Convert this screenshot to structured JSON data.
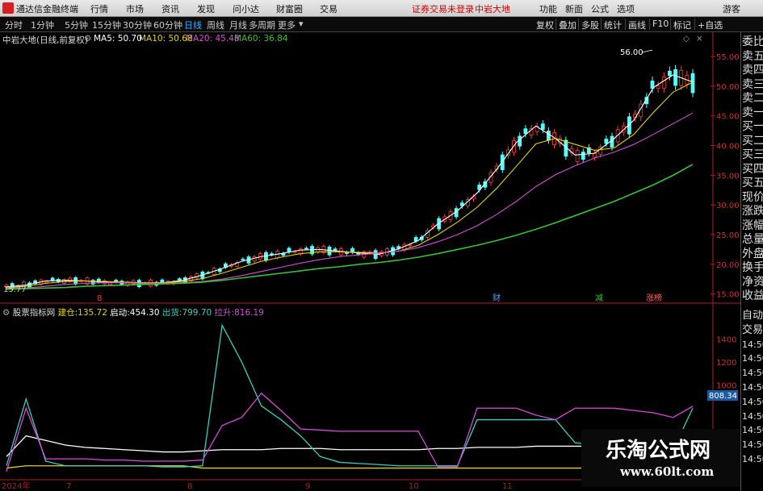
{
  "topbar": {
    "app_title": "通达信金融终端",
    "menus": [
      "行情",
      "市场",
      "资讯",
      "发现",
      "问小达",
      "财富圈",
      "交易"
    ],
    "notice": "证券交易未登录",
    "stock": "中岩大地",
    "right_menus": [
      "功能",
      "新面",
      "公式",
      "选项"
    ],
    "guest": "游客"
  },
  "periods": [
    "分时",
    "1分钟",
    "5分钟",
    "15分钟",
    "30分钟",
    "60分钟",
    "日线",
    "周线",
    "月线",
    "多周期",
    "更多"
  ],
  "active_period": "日线",
  "right_buttons": [
    "复权",
    "叠加",
    "多股",
    "统计",
    "画线",
    "F10",
    "标记",
    "+自选"
  ],
  "main_chart": {
    "title": "中岩大地(日线,前复权)",
    "ma": [
      {
        "label": "MA5: 50.70",
        "color": "#ffffff"
      },
      {
        "label": "MA10: 50.68",
        "color": "#e6d200"
      },
      {
        "label": "MA20: 45.48",
        "color": "#d84bd8"
      },
      {
        "label": "MA60: 36.84",
        "color": "#36c236"
      }
    ],
    "price_high_label": "56.00",
    "price_low_label": "15.77",
    "markers": [
      {
        "text": "财",
        "color": "#4aa3ff"
      },
      {
        "text": "减",
        "color": "#36c236"
      },
      {
        "text": "涨榜",
        "color": "#ff6060"
      },
      {
        "text": "8",
        "color": "#ff3030"
      }
    ]
  },
  "indicator": {
    "title": "股票指标网",
    "items": [
      {
        "label": "建仓:",
        "value": "135.72",
        "label_color": "#e6d200",
        "value_color": "#e6d200"
      },
      {
        "label": "启动:",
        "value": "454.30",
        "label_color": "#ffffff",
        "value_color": "#ffffff"
      },
      {
        "label": "出货:",
        "value": "799.70",
        "label_color": "#36d0c0",
        "value_color": "#36d0c0"
      },
      {
        "label": "拉升:",
        "value": "816.19",
        "label_color": "#d84bd8",
        "value_color": "#d84bd8"
      }
    ],
    "current_value": "808.34"
  },
  "right_panel_top": [
    "委比",
    "卖五",
    "卖四",
    "卖三",
    "卖二",
    "卖一",
    "买一",
    "买二",
    "买三",
    "买四",
    "买五",
    "现价",
    "涨跌",
    "涨幅",
    "总量",
    "外盘",
    "换手",
    "净资",
    "收益"
  ],
  "right_panel_bottom": [
    "自动",
    "交易",
    "14:50",
    "14:50",
    "14:50",
    "14:50",
    "14:50",
    "14:50",
    "14:50",
    "14:50",
    "14:50"
  ],
  "watermark": {
    "name": "乐淘公式网",
    "url": "www.60lt.com"
  },
  "chart_data": [
    {
      "type": "candlestick",
      "ylim": [
        14,
        58
      ],
      "y_ticks": [
        "55.00",
        "50.00",
        "45.00",
        "40.00",
        "35.00",
        "30.00",
        "25.00",
        "20.00",
        "15.00"
      ],
      "series": [
        {
          "name": "MA5",
          "values": [
            16.2,
            16.5,
            17.2,
            17.3,
            17.2,
            17.0,
            16.9,
            16.8,
            16.9,
            17.3,
            18.2,
            19.3,
            20.5,
            21.3,
            21.8,
            22.4,
            22.5,
            22.2,
            21.9,
            21.7,
            22.6,
            24.0,
            26.8,
            29.0,
            32.0,
            36.0,
            40.5,
            43.3,
            41.2,
            38.4,
            38.7,
            41.2,
            44.3,
            49.8,
            51.9,
            50.7
          ]
        },
        {
          "name": "MA10",
          "values": [
            16.0,
            16.3,
            16.8,
            17.1,
            17.2,
            17.1,
            17.0,
            16.9,
            16.9,
            17.1,
            17.6,
            18.5,
            19.5,
            20.5,
            21.2,
            21.8,
            22.1,
            22.1,
            22.0,
            21.9,
            22.2,
            23.2,
            25.0,
            27.1,
            29.6,
            32.8,
            36.5,
            40.3,
            41.2,
            40.2,
            39.2,
            39.6,
            41.9,
            45.6,
            49.0,
            50.68
          ]
        },
        {
          "name": "MA20",
          "values": [
            15.9,
            16.0,
            16.3,
            16.6,
            16.8,
            16.9,
            16.9,
            16.8,
            16.8,
            16.9,
            17.1,
            17.5,
            18.1,
            18.8,
            19.5,
            20.2,
            20.8,
            21.3,
            21.6,
            21.9,
            22.2,
            22.8,
            23.8,
            25.0,
            26.5,
            28.4,
            30.6,
            33.1,
            35.1,
            36.6,
            37.9,
            38.9,
            40.2,
            41.9,
            43.7,
            45.48
          ]
        },
        {
          "name": "MA60",
          "values": [
            15.8,
            15.9,
            16.0,
            16.1,
            16.3,
            16.4,
            16.5,
            16.6,
            16.7,
            16.8,
            17.0,
            17.3,
            17.7,
            18.1,
            18.5,
            18.9,
            19.3,
            19.6,
            20.0,
            20.3,
            20.7,
            21.2,
            21.8,
            22.5,
            23.2,
            24.0,
            24.9,
            25.9,
            27.0,
            28.2,
            29.4,
            30.6,
            32.0,
            33.4,
            35.0,
            36.84
          ]
        }
      ]
    },
    {
      "type": "line",
      "ylim": [
        200,
        1600
      ],
      "y_ticks": [
        "1400",
        "1200",
        "1000"
      ],
      "series": [
        {
          "name": "建仓",
          "values": [
            280,
            300,
            300,
            300,
            300,
            300,
            300,
            300,
            300,
            300,
            280,
            280,
            280,
            280,
            280,
            280,
            280,
            280,
            280,
            280,
            280,
            280,
            280,
            280,
            280,
            280,
            280,
            280,
            280,
            280,
            280,
            280,
            280,
            280,
            280,
            280
          ]
        },
        {
          "name": "启动",
          "values": [
            380,
            560,
            520,
            480,
            460,
            450,
            440,
            430,
            420,
            420,
            430,
            440,
            440,
            440,
            450,
            450,
            450,
            440,
            440,
            440,
            440,
            440,
            450,
            450,
            460,
            460,
            460,
            470,
            470,
            470,
            470,
            470,
            470,
            470,
            460,
            454
          ]
        },
        {
          "name": "出货",
          "values": [
            300,
            880,
            340,
            300,
            300,
            300,
            300,
            300,
            290,
            290,
            300,
            1520,
            1200,
            820,
            700,
            560,
            380,
            330,
            320,
            310,
            300,
            300,
            300,
            300,
            700,
            700,
            700,
            700,
            700,
            500,
            480,
            480,
            470,
            460,
            440,
            800
          ]
        },
        {
          "name": "拉升",
          "values": [
            250,
            800,
            360,
            360,
            360,
            350,
            350,
            340,
            340,
            340,
            350,
            650,
            720,
            930,
            780,
            620,
            610,
            600,
            600,
            600,
            600,
            600,
            290,
            290,
            800,
            800,
            800,
            740,
            700,
            800,
            800,
            800,
            780,
            760,
            720,
            816
          ]
        }
      ]
    }
  ]
}
